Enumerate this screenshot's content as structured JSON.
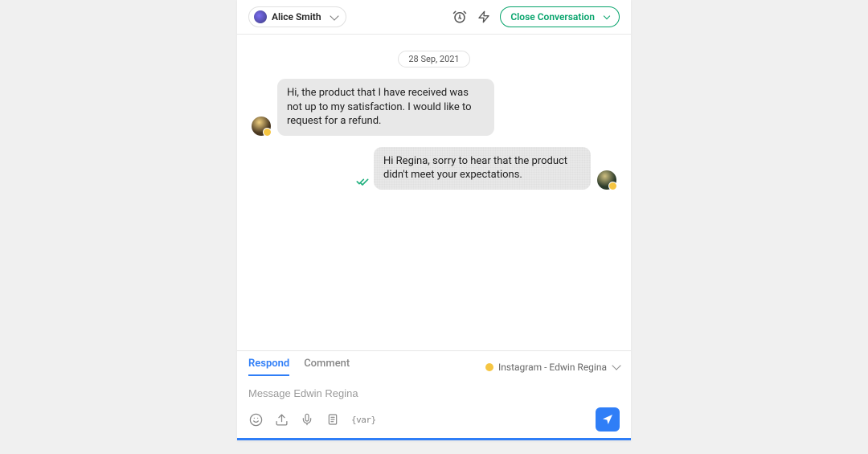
{
  "header": {
    "agent_name": "Alice Smith",
    "close_label": "Close Conversation"
  },
  "date": "28 Sep, 2021",
  "messages": {
    "incoming1": "Hi, the product that I have received was not up to my satisfaction. I would like to request for a refund.",
    "outgoing1": "Hi Regina, sorry to hear that the product didn't meet your expectations."
  },
  "composer": {
    "tab_respond": "Respond",
    "tab_comment": "Comment",
    "channel_label": "Instagram - Edwin Regina",
    "placeholder": "Message Edwin Regina",
    "var_label": "{var}"
  }
}
